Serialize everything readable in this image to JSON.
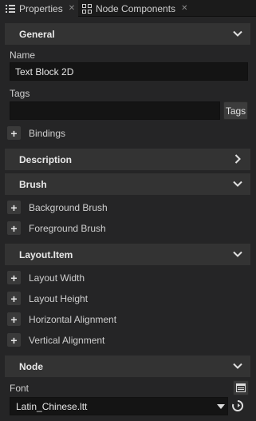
{
  "tabs": [
    {
      "label": "Properties",
      "icon": "list-icon",
      "active": true
    },
    {
      "label": "Node Components",
      "icon": "components-icon",
      "active": false
    }
  ],
  "general": {
    "title": "General",
    "name_label": "Name",
    "name_value": "Text Block 2D",
    "tags_label": "Tags",
    "tags_value": "",
    "tags_button": "Tags",
    "bindings_label": "Bindings"
  },
  "description": {
    "title": "Description"
  },
  "brush": {
    "title": "Brush",
    "items": [
      "Background Brush",
      "Foreground Brush"
    ]
  },
  "layout_item": {
    "title": "Layout.Item",
    "items": [
      "Layout Width",
      "Layout Height",
      "Horizontal Alignment",
      "Vertical Alignment"
    ]
  },
  "node": {
    "title": "Node",
    "font_label": "Font",
    "font_value": "Latin_Chinese.ltt"
  },
  "colors": {
    "panel_bg": "#252526",
    "section_bg": "#333333",
    "field_bg": "#141414",
    "tabbar_bg": "#1b1b1b"
  }
}
